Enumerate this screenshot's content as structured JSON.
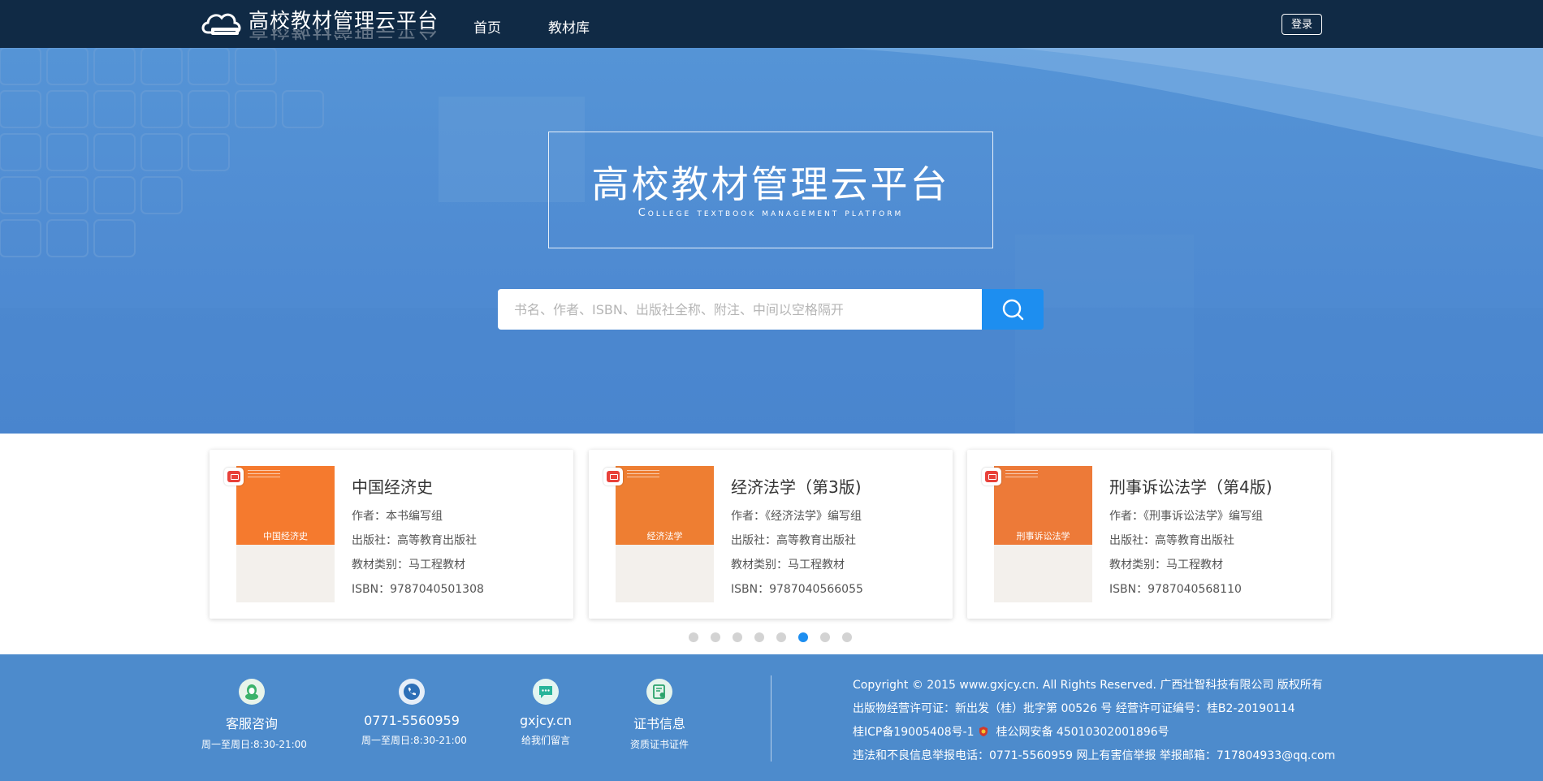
{
  "header": {
    "logo_text": "高校教材管理云平台",
    "nav": [
      "首页",
      "教材库"
    ],
    "login_label": "登录"
  },
  "hero": {
    "title_cn": "高校教材管理云平台",
    "title_en": "College textbook management platform",
    "search_placeholder": "书名、作者、ISBN、出版社全称、附注、中间以空格隔开"
  },
  "books": [
    {
      "title": "中国经济史",
      "author": "作者：本书编写组",
      "publisher": "出版社：高等教育出版社",
      "category": "教材类别：马工程教材",
      "isbn": "ISBN：9787040501308",
      "cover_title": "中国经济史",
      "cover_color": "#f57a2e"
    },
    {
      "title": "经济法学（第3版)",
      "author": "作者：《经济法学》编写组",
      "publisher": "出版社：高等教育出版社",
      "category": "教材类别：马工程教材",
      "isbn": "ISBN：9787040566055",
      "cover_title": "经济法学",
      "cover_color": "#ee7e32"
    },
    {
      "title": "刑事诉讼法学（第4版)",
      "author": "作者：《刑事诉讼法学》编写组",
      "publisher": "出版社：高等教育出版社",
      "category": "教材类别：马工程教材",
      "isbn": "ISBN：9787040568110",
      "cover_title": "刑事诉讼法学",
      "cover_color": "#ed7a38"
    }
  ],
  "carousel": {
    "total": 8,
    "active_index": 5
  },
  "footer": {
    "contacts": [
      {
        "main": "客服咨询",
        "sub": "周一至周日:8:30-21:00",
        "icon": "qq-icon"
      },
      {
        "main": "0771-5560959",
        "sub": "周一至周日:8:30-21:00",
        "icon": "phone-icon"
      },
      {
        "main": "gxjcy.cn",
        "sub": "给我们留言",
        "icon": "message-icon"
      },
      {
        "main": "证书信息",
        "sub": "资质证书证件",
        "icon": "certificate-icon"
      }
    ],
    "copyright": "Copyright © 2015 www.gxjcy.cn. All Rights Reserved. 广西壮智科技有限公司 版权所有",
    "license": "出版物经营许可证：新出发（桂）批字第 00526 号 经营许可证编号：桂B2-20190114",
    "icp": "桂ICP备19005408号-1",
    "police": "桂公网安备 45010302001896号",
    "report": "违法和不良信息举报电话：0771-5560959 网上有害信举报 举报邮箱：717804933@qq.com"
  },
  "colors": {
    "header_bg": "#102a45",
    "hero_bg": "#4f8bd2",
    "accent": "#1d8ef0",
    "footer_bg": "#4d8bcc"
  }
}
